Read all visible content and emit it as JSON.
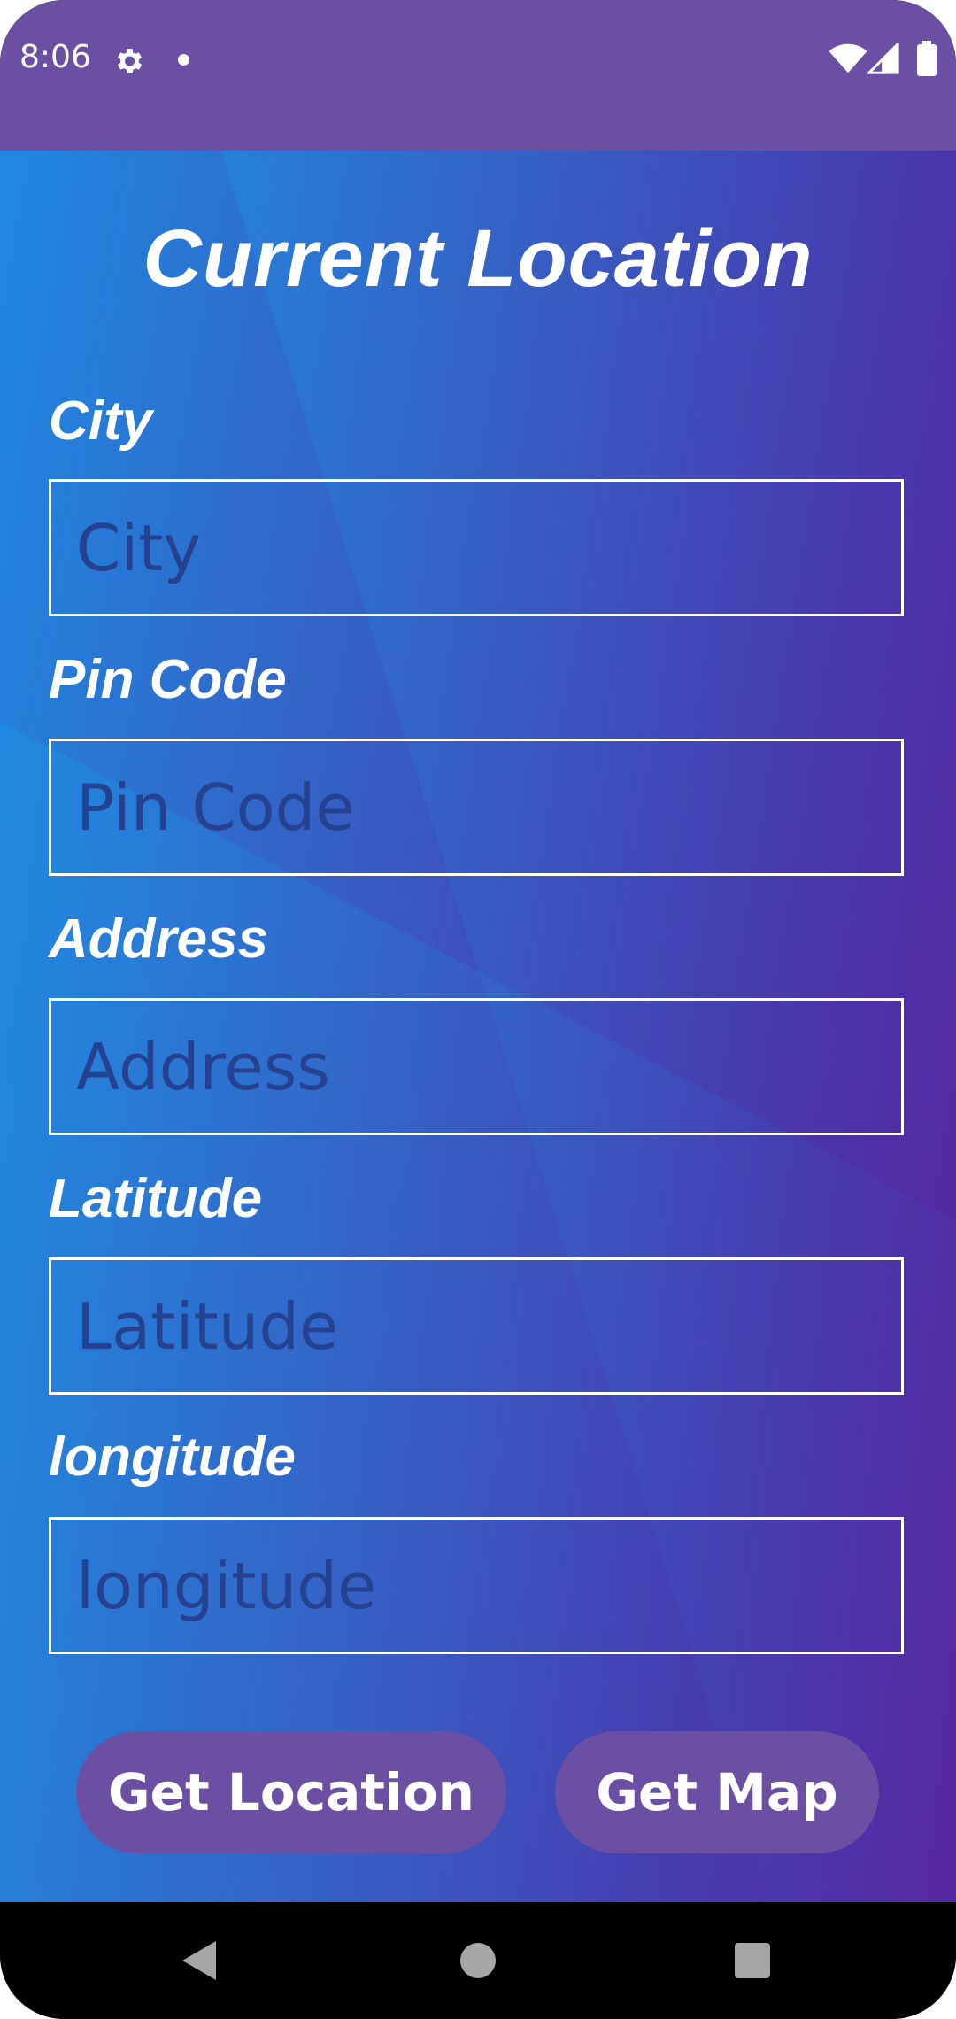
{
  "status_bar": {
    "time": "8:06",
    "icons": [
      "gear-icon",
      "dot-icon",
      "wifi-icon",
      "signal-icon",
      "battery-icon"
    ]
  },
  "page": {
    "title": "Current Location"
  },
  "form": {
    "fields": [
      {
        "label": "City",
        "placeholder": "City",
        "value": ""
      },
      {
        "label": "Pin Code",
        "placeholder": "Pin Code",
        "value": ""
      },
      {
        "label": "Address",
        "placeholder": "Address",
        "value": ""
      },
      {
        "label": "Latitude",
        "placeholder": "Latitude",
        "value": ""
      },
      {
        "label": "longitude",
        "placeholder": "longitude",
        "value": ""
      }
    ]
  },
  "actions": {
    "get_location_label": "Get Location",
    "get_map_label": "Get Map"
  },
  "nav_bar": {
    "icons": [
      "back-icon",
      "home-icon",
      "recents-icon"
    ]
  },
  "colors": {
    "status_bar": "#6a4fa3",
    "button": "#6a4fa3",
    "gradient_start": "#1f88e0",
    "gradient_end": "#5a1f9a",
    "placeholder": "#25418f"
  }
}
